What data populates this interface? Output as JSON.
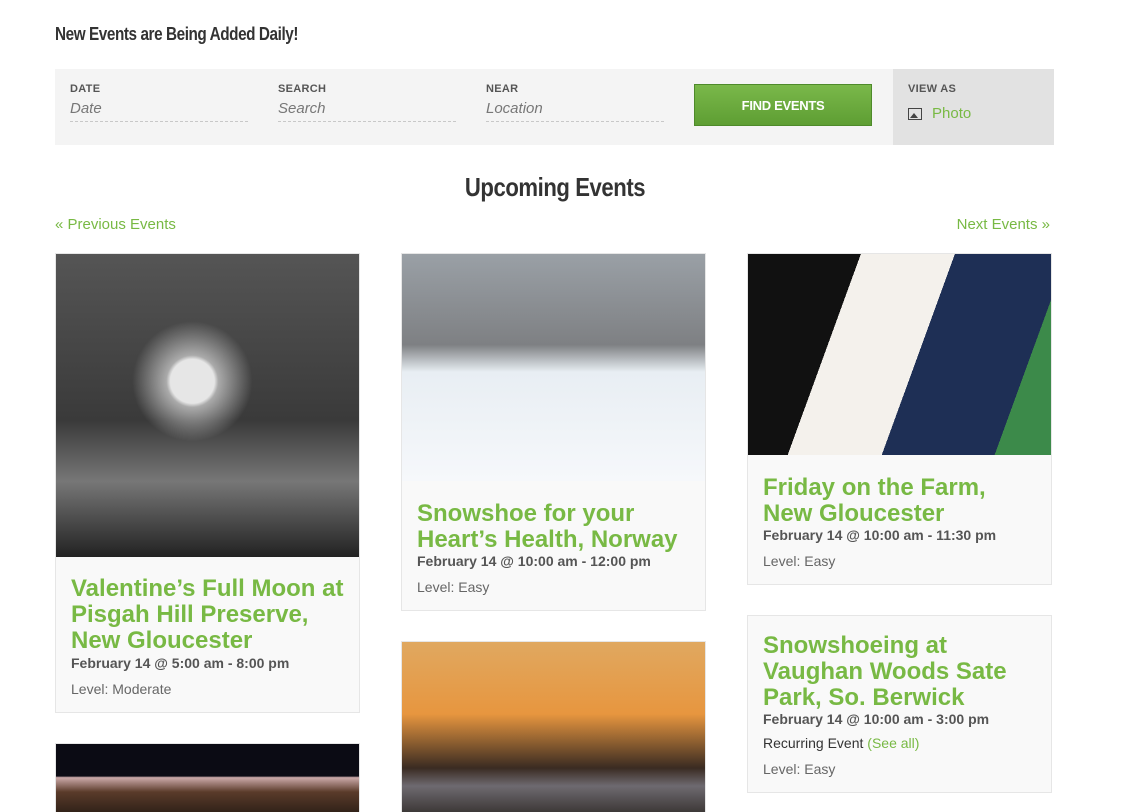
{
  "notice": "New Events are Being Added Daily!",
  "search_bar": {
    "date_label": "DATE",
    "date_placeholder": "Date",
    "search_label": "SEARCH",
    "search_placeholder": "Search",
    "near_label": "NEAR",
    "near_placeholder": "Location",
    "find_button": "FIND EVENTS",
    "view_as_label": "VIEW AS",
    "view_as_option": "Photo"
  },
  "heading": "Upcoming Events",
  "nav": {
    "prev": "« Previous Events",
    "next": "Next Events »"
  },
  "events": [
    {
      "title": "Valentine’s Full Moon at Pisgah Hill Preserve, New Gloucester",
      "when": "February 14 @ 5:00 am - 8:00 pm",
      "level": "Level: Moderate"
    },
    {
      "title": "Snowshoe for your Heart’s Health, Norway",
      "when": "February 14 @ 10:00 am - 12:00 pm",
      "level": "Level: Easy"
    },
    {
      "title": "Friday on the Farm, New Gloucester",
      "when": "February 14 @ 10:00 am - 11:30 pm",
      "level": "Level: Easy"
    },
    {
      "title": "Snowshoeing at Vaughan Woods Sate Park, So. Berwick",
      "when": "February 14 @ 10:00 am - 3:00 pm",
      "recurring": "Recurring Event",
      "see_all": "(See all)",
      "level": "Level: Easy"
    }
  ],
  "colors": {
    "accent": "#78b944",
    "button": "#6aa93c"
  }
}
